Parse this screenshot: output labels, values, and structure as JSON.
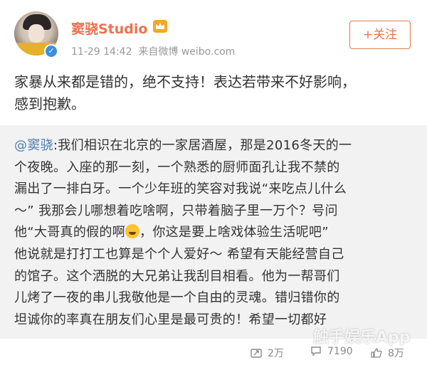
{
  "post": {
    "username": "窦骁Studio",
    "timestamp": "11-29 14:42",
    "source": "来自微博 weibo.com",
    "follow_label": "+关注",
    "verified_mark": "✓",
    "text_line1": "家暴从来都是错的，绝不支持！表达若带来不好影响，",
    "text_line2": "感到抱歉。"
  },
  "repost": {
    "mention": "@窦骁",
    "l1": ":我们相识在北京的一家居酒屋，那是2016冬天的一",
    "l2": "个夜晚。入座的那一刻，一个熟悉的厨师面孔让我不禁的",
    "l3": "漏出了一排白牙。一个少年班的笑容对我说“来吃点儿什么",
    "l4": "～” 我那会儿哪想着吃啥啊，只带着脑子里一万个？号问",
    "l5a": "他“大哥真的假的啊",
    "l5b": "，你这是要上啥戏体验生活呢吧”",
    "l6": "他说就是打打工也算是个个人爱好～ 希望有天能经营自己",
    "l7": "的馆子。这个洒脱的大兄弟让我刮目相看。他为一帮哥们",
    "l8": "儿烤了一夜的串儿我敬他是一个自由的灵魂。错归错你的",
    "l9": "坦诚你的率真在朋友们心里是最可贵的！希望一切都好"
  },
  "actions": {
    "repost_count": "2万",
    "comment_count": "7190",
    "like_count": "8万"
  },
  "watermark": "触手娱乐App",
  "colors": {
    "accent": "#eb7350",
    "link": "#507daf",
    "verified": "#3a8fe0"
  }
}
